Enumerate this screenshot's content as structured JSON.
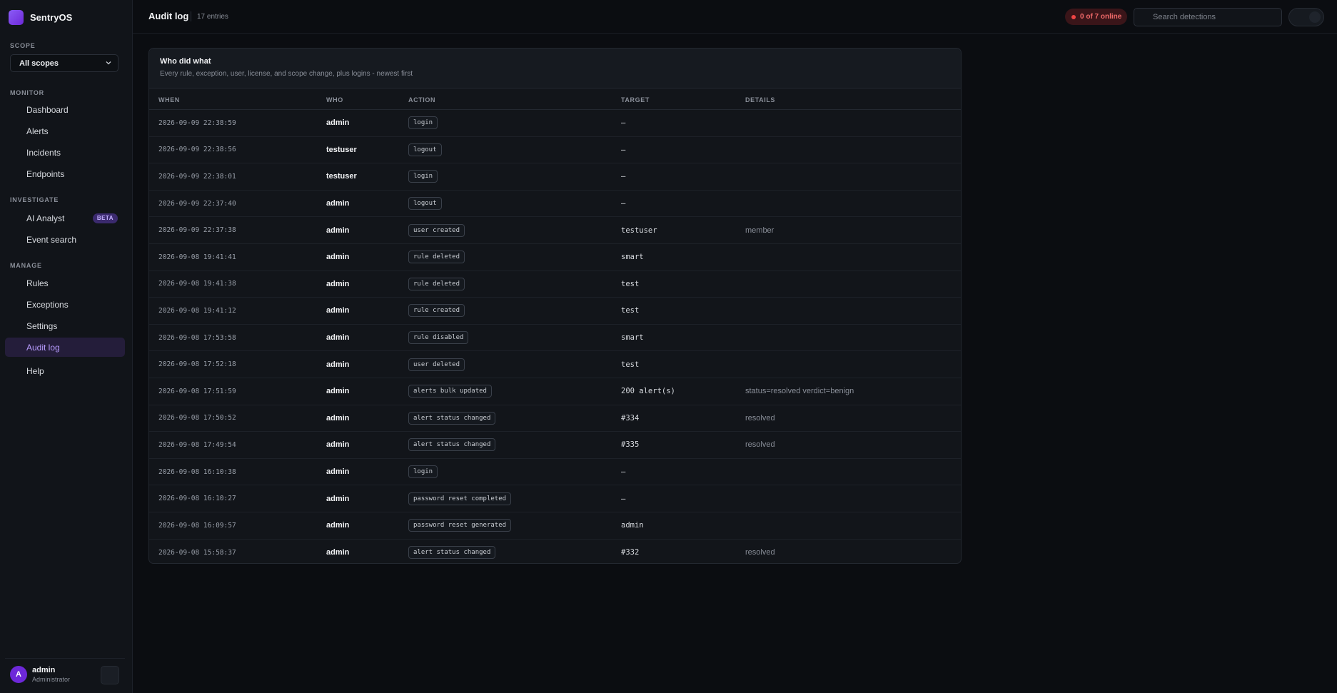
{
  "app": {
    "name": "SentryOS"
  },
  "sidebar": {
    "scope_label": "SCOPE",
    "scope_value": "All scopes",
    "sections": {
      "monitor": "MONITOR",
      "investigate": "INVESTIGATE",
      "manage": "MANAGE"
    },
    "items": [
      {
        "label": "Dashboard"
      },
      {
        "label": "Alerts"
      },
      {
        "label": "Incidents"
      },
      {
        "label": "Endpoints"
      },
      {
        "label": "AI Analyst",
        "badge": "BETA"
      },
      {
        "label": "Event search"
      },
      {
        "label": "Rules"
      },
      {
        "label": "Exceptions"
      },
      {
        "label": "Settings"
      },
      {
        "label": "Audit log",
        "active": true
      },
      {
        "label": "Help"
      }
    ],
    "user": {
      "initial": "A",
      "name": "admin",
      "role": "Administrator"
    }
  },
  "header": {
    "title": "Audit log",
    "entries": "17 entries",
    "online_badge": "0 of 7 online",
    "search_placeholder": "Search detections"
  },
  "card": {
    "title": "Who did what",
    "subtitle": "Every rule, exception, user, license, and scope change, plus logins - newest first"
  },
  "table": {
    "columns": [
      "WHEN",
      "WHO",
      "ACTION",
      "TARGET",
      "DETAILS"
    ],
    "rows": [
      {
        "when": "2026-09-09 22:38:59",
        "who": "admin",
        "action": "login",
        "target": "—",
        "details": ""
      },
      {
        "when": "2026-09-09 22:38:56",
        "who": "testuser",
        "action": "logout",
        "target": "—",
        "details": ""
      },
      {
        "when": "2026-09-09 22:38:01",
        "who": "testuser",
        "action": "login",
        "target": "—",
        "details": ""
      },
      {
        "when": "2026-09-09 22:37:40",
        "who": "admin",
        "action": "logout",
        "target": "—",
        "details": ""
      },
      {
        "when": "2026-09-09 22:37:38",
        "who": "admin",
        "action": "user created",
        "target": "testuser",
        "details": "member"
      },
      {
        "when": "2026-09-08 19:41:41",
        "who": "admin",
        "action": "rule deleted",
        "target": "smart",
        "details": ""
      },
      {
        "when": "2026-09-08 19:41:38",
        "who": "admin",
        "action": "rule deleted",
        "target": "test",
        "details": ""
      },
      {
        "when": "2026-09-08 19:41:12",
        "who": "admin",
        "action": "rule created",
        "target": "test",
        "details": ""
      },
      {
        "when": "2026-09-08 17:53:58",
        "who": "admin",
        "action": "rule disabled",
        "target": "smart",
        "details": ""
      },
      {
        "when": "2026-09-08 17:52:18",
        "who": "admin",
        "action": "user deleted",
        "target": "test",
        "details": ""
      },
      {
        "when": "2026-09-08 17:51:59",
        "who": "admin",
        "action": "alerts bulk updated",
        "target": "200 alert(s)",
        "details": "status=resolved verdict=benign"
      },
      {
        "when": "2026-09-08 17:50:52",
        "who": "admin",
        "action": "alert status changed",
        "target": "#334",
        "details": "resolved"
      },
      {
        "when": "2026-09-08 17:49:54",
        "who": "admin",
        "action": "alert status changed",
        "target": "#335",
        "details": "resolved"
      },
      {
        "when": "2026-09-08 16:10:38",
        "who": "admin",
        "action": "login",
        "target": "—",
        "details": ""
      },
      {
        "when": "2026-09-08 16:10:27",
        "who": "admin",
        "action": "password reset completed",
        "target": "—",
        "details": ""
      },
      {
        "when": "2026-09-08 16:09:57",
        "who": "admin",
        "action": "password reset generated",
        "target": "admin",
        "details": ""
      },
      {
        "when": "2026-09-08 15:58:37",
        "who": "admin",
        "action": "alert status changed",
        "target": "#332",
        "details": "resolved"
      }
    ]
  },
  "colors": {
    "accent": "#8b5cf6",
    "active_nav_bg": "#241d3a",
    "danger": "#ef4444",
    "background": "#0b0d11"
  },
  "icons": {
    "brand": "brand-logo-icon",
    "scope_dropdown": "chevron-down-icon",
    "online_status": "status-dot-icon"
  }
}
